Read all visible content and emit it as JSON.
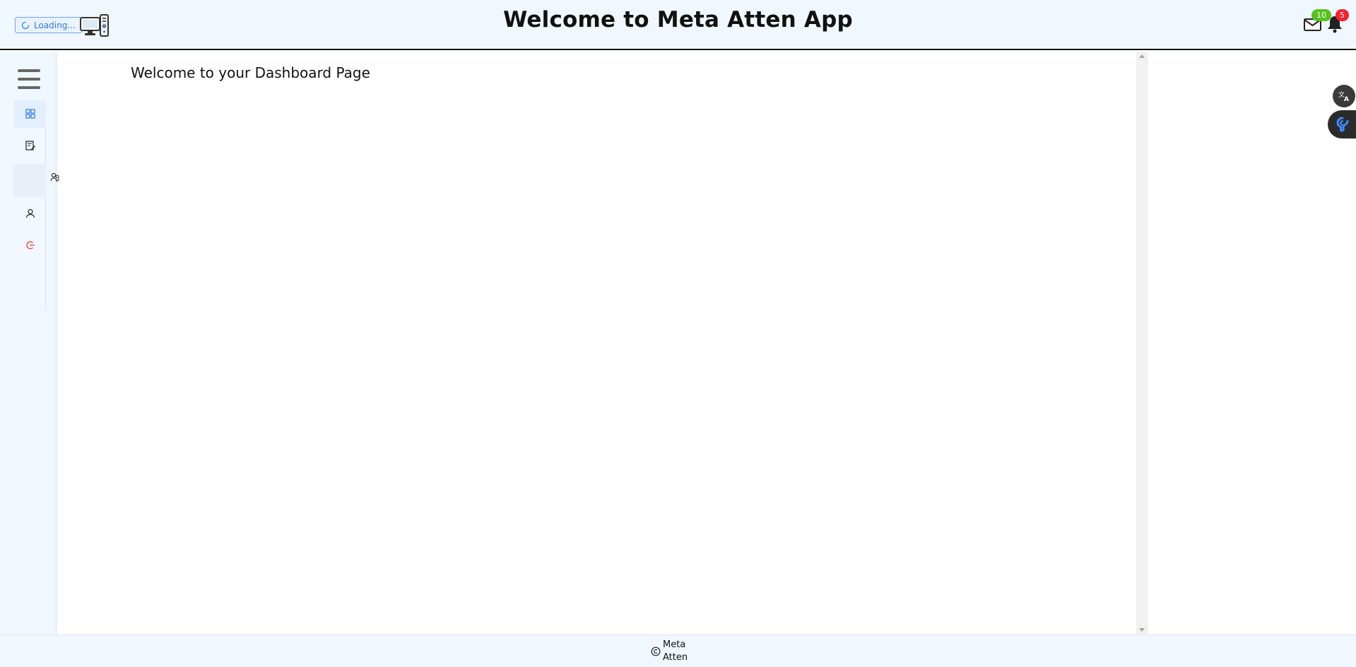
{
  "header": {
    "loading_label": "Loading...",
    "title": "Welcome to Meta Atten App",
    "mail_count": "10",
    "notification_count": "5"
  },
  "sidebar": {
    "items": [
      {
        "icon": "dashboard-icon",
        "active": true
      },
      {
        "icon": "edit-document-icon"
      },
      {
        "icon": "users-icon"
      },
      {
        "icon": "user-icon"
      },
      {
        "icon": "logout-icon"
      }
    ]
  },
  "main": {
    "heading": "Welcome to your Dashboard Page"
  },
  "footer": {
    "text": "Meta Atten"
  },
  "colors": {
    "accent": "#2f7be0",
    "header_bg": "#f0f7ff",
    "mail_badge": "#52c41a",
    "bell_badge": "#f5222d",
    "logout": "#e53935"
  }
}
